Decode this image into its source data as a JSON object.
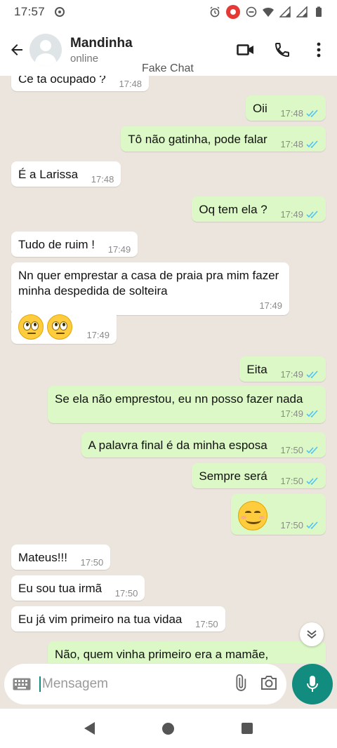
{
  "status_bar": {
    "time": "17:57"
  },
  "header": {
    "contact_name": "Mandinha",
    "contact_status": "online",
    "watermark": "Fake Chat"
  },
  "messages": [
    {
      "dir": "in",
      "text": "Cê tá ocupado ?",
      "time": "17:48"
    },
    {
      "dir": "out",
      "text": "Oii",
      "time": "17:48"
    },
    {
      "dir": "out",
      "text": "Tô não gatinha, pode falar",
      "time": "17:48"
    },
    {
      "dir": "in",
      "text": "É a Larissa",
      "time": "17:48"
    },
    {
      "dir": "out",
      "text": "Oq tem ela ?",
      "time": "17:49"
    },
    {
      "dir": "in",
      "text": "Tudo de ruim !",
      "time": "17:49"
    },
    {
      "dir": "in",
      "text": "Nn quer emprestar a casa de praia pra mim fazer minha despedida de solteira",
      "time": "17:49"
    },
    {
      "dir": "in",
      "emoji": "face-with-rolling-eyes x2",
      "time": "17:49"
    },
    {
      "dir": "out",
      "text": "Eita",
      "time": "17:49"
    },
    {
      "dir": "out",
      "text": "Se ela não emprestou, eu nn posso fazer nada",
      "time": "17:49"
    },
    {
      "dir": "out",
      "text": "A palavra final é da minha esposa",
      "time": "17:50"
    },
    {
      "dir": "out",
      "text": "Sempre será",
      "time": "17:50"
    },
    {
      "dir": "out",
      "emoji": "smiling-face",
      "time": "17:50"
    },
    {
      "dir": "in",
      "text": "Mateus!!!",
      "time": "17:50"
    },
    {
      "dir": "in",
      "text": "Eu sou tua irmã",
      "time": "17:50"
    },
    {
      "dir": "in",
      "text": "Eu já vim primeiro na tua vidaa",
      "time": "17:50"
    },
    {
      "dir": "out",
      "text": "Não, quem vinha primeiro era a mamãe,",
      "time": ""
    }
  ],
  "composer": {
    "placeholder": "Mensagem"
  },
  "icons": {
    "back": "arrow-left-icon",
    "video": "video-call-icon",
    "call": "phone-icon",
    "menu": "more-vert-icon",
    "keyboard": "keyboard-icon",
    "attach": "paperclip-icon",
    "camera": "camera-icon",
    "mic": "microphone-icon",
    "scroll": "double-chevron-down-icon"
  },
  "colors": {
    "accent": "#128c7e",
    "outgoing_bubble": "#dcf8c6",
    "incoming_bubble": "#ffffff",
    "read_ticks": "#4fc3f7"
  }
}
